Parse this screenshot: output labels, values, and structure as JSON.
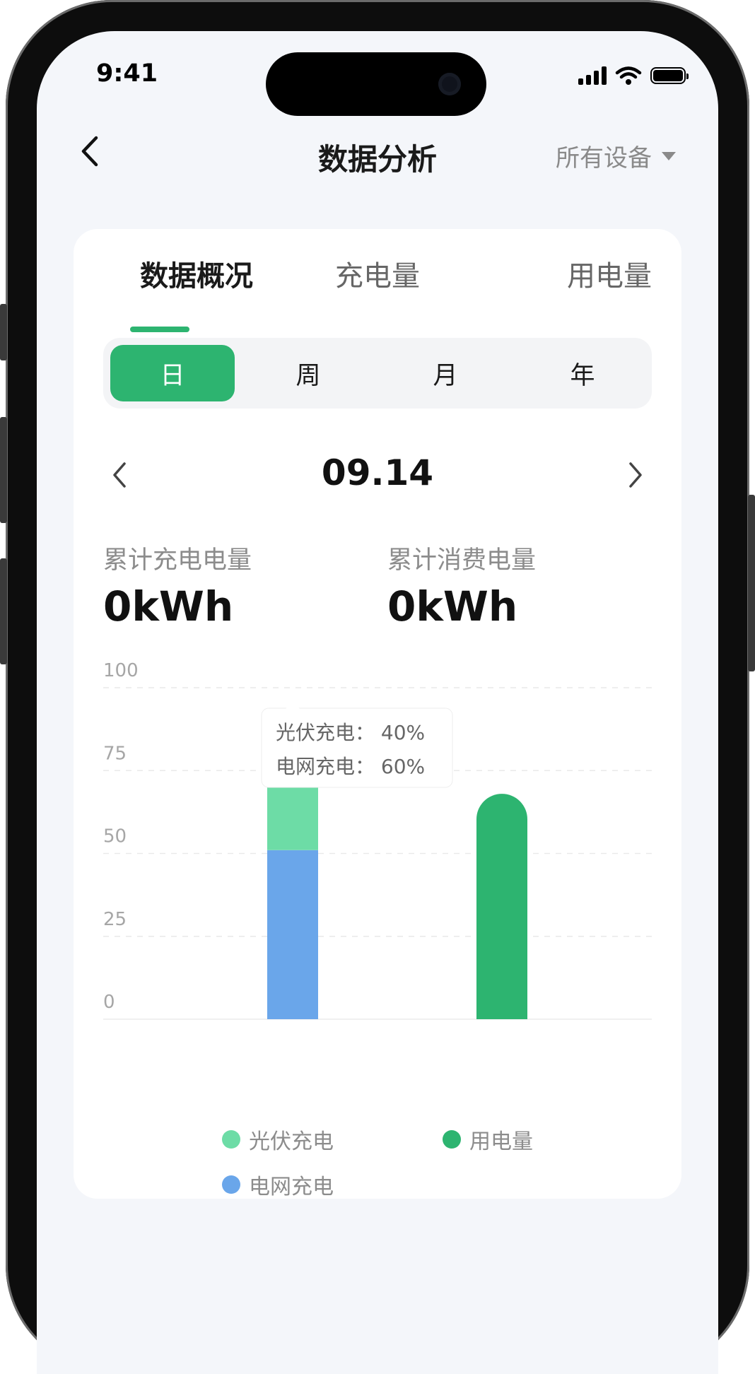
{
  "status_bar": {
    "time": "9:41"
  },
  "nav": {
    "title": "数据分析",
    "device_selector": "所有设备"
  },
  "tabs": [
    {
      "label": "数据概况",
      "active": true
    },
    {
      "label": "充电量",
      "active": false
    },
    {
      "label": "用电量",
      "active": false
    }
  ],
  "periods": [
    {
      "label": "日",
      "active": true
    },
    {
      "label": "周",
      "active": false
    },
    {
      "label": "月",
      "active": false
    },
    {
      "label": "年",
      "active": false
    }
  ],
  "date": "09.14",
  "stats": {
    "charge_label": "累计充电电量",
    "charge_value": "0kWh",
    "consume_label": "累计消费电量",
    "consume_value": "0kWh"
  },
  "colors": {
    "accent": "#2db470",
    "solar": "#6ddca6",
    "grid": "#6aa6ea",
    "usage": "#2db470"
  },
  "chart_data": {
    "type": "bar",
    "stacked": true,
    "ylim": [
      0,
      100
    ],
    "yticks": [
      "100",
      "75",
      "50",
      "25",
      "0"
    ],
    "categories": [
      "",
      ""
    ],
    "series": [
      {
        "name": "电网充电",
        "color": "#6aa6ea",
        "values": [
          51,
          0
        ]
      },
      {
        "name": "光伏充电",
        "color": "#6ddca6",
        "values": [
          42,
          0
        ]
      },
      {
        "name": "用电量",
        "color": "#2db470",
        "values": [
          0,
          68
        ]
      }
    ],
    "legend": [
      "光伏充电",
      "用电量",
      "电网充电"
    ],
    "tooltip": {
      "line1_label": "光伏充电：",
      "line1_value": "40%",
      "line2_label": "电网充电：",
      "line2_value": "60%"
    },
    "grid": true
  }
}
